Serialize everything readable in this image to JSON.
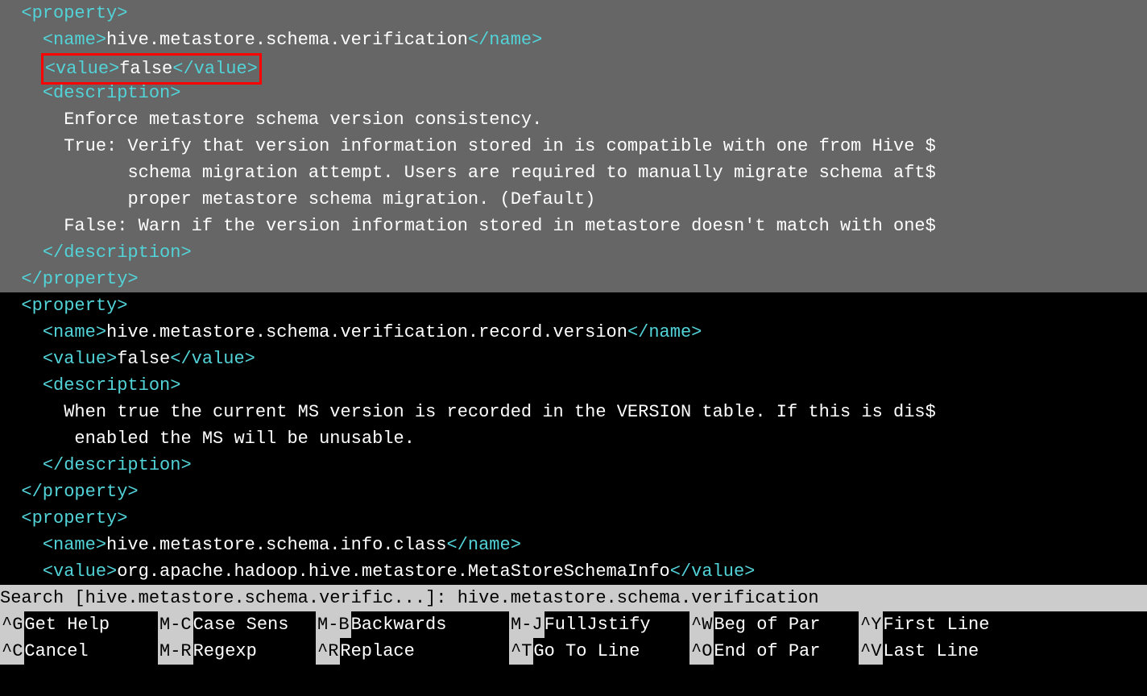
{
  "editor": {
    "property1": {
      "open_tag": "<property>",
      "name_open": "<name>",
      "name_value": "hive.metastore.schema.verification",
      "name_close": "</name>",
      "value_open": "<value>",
      "value_text": "false",
      "value_close": "</value>",
      "desc_open": "<description>",
      "desc_line1": "Enforce metastore schema version consistency.",
      "desc_line2": "True: Verify that version information stored in is compatible with one from Hive $",
      "desc_line3": "schema migration attempt. Users are required to manually migrate schema aft$",
      "desc_line4": "proper metastore schema migration. (Default)",
      "desc_line5": "False: Warn if the version information stored in metastore doesn't match with one$",
      "desc_close": "</description>",
      "close_tag": "</property>"
    },
    "property2": {
      "open_tag": "<property>",
      "name_open": "<name>",
      "name_value": "hive.metastore.schema.verification.record.version",
      "name_close": "</name>",
      "value_open": "<value>",
      "value_text": "false",
      "value_close": "</value>",
      "desc_open": "<description>",
      "desc_line1": "When true the current MS version is recorded in the VERSION table. If this is dis$",
      "desc_line2": "enabled the MS will be unusable.",
      "desc_close": "</description>",
      "close_tag": "</property>"
    },
    "property3": {
      "open_tag": "<property>",
      "name_open": "<name>",
      "name_value": "hive.metastore.schema.info.class",
      "name_close": "</name>",
      "value_open": "<value>",
      "value_text": "org.apache.hadoop.hive.metastore.MetaStoreSchemaInfo",
      "value_close": "</value>"
    }
  },
  "status": {
    "prompt": "Search [hive.metastore.schema.verific...]: ",
    "query": "hive.metastore.schema.verification"
  },
  "menu": {
    "row1": [
      {
        "key": "^G",
        "label": "Get Help"
      },
      {
        "key": "M-C",
        "label": "Case Sens"
      },
      {
        "key": "M-B",
        "label": "Backwards"
      },
      {
        "key": "M-J",
        "label": "FullJstify"
      },
      {
        "key": "^W",
        "label": "Beg of Par"
      },
      {
        "key": "^Y",
        "label": "First Line"
      }
    ],
    "row2": [
      {
        "key": "^C",
        "label": "Cancel"
      },
      {
        "key": "M-R",
        "label": "Regexp"
      },
      {
        "key": "^R",
        "label": "Replace"
      },
      {
        "key": "^T",
        "label": "Go To Line"
      },
      {
        "key": "^O",
        "label": "End of Par"
      },
      {
        "key": "^V",
        "label": "Last Line"
      }
    ]
  }
}
